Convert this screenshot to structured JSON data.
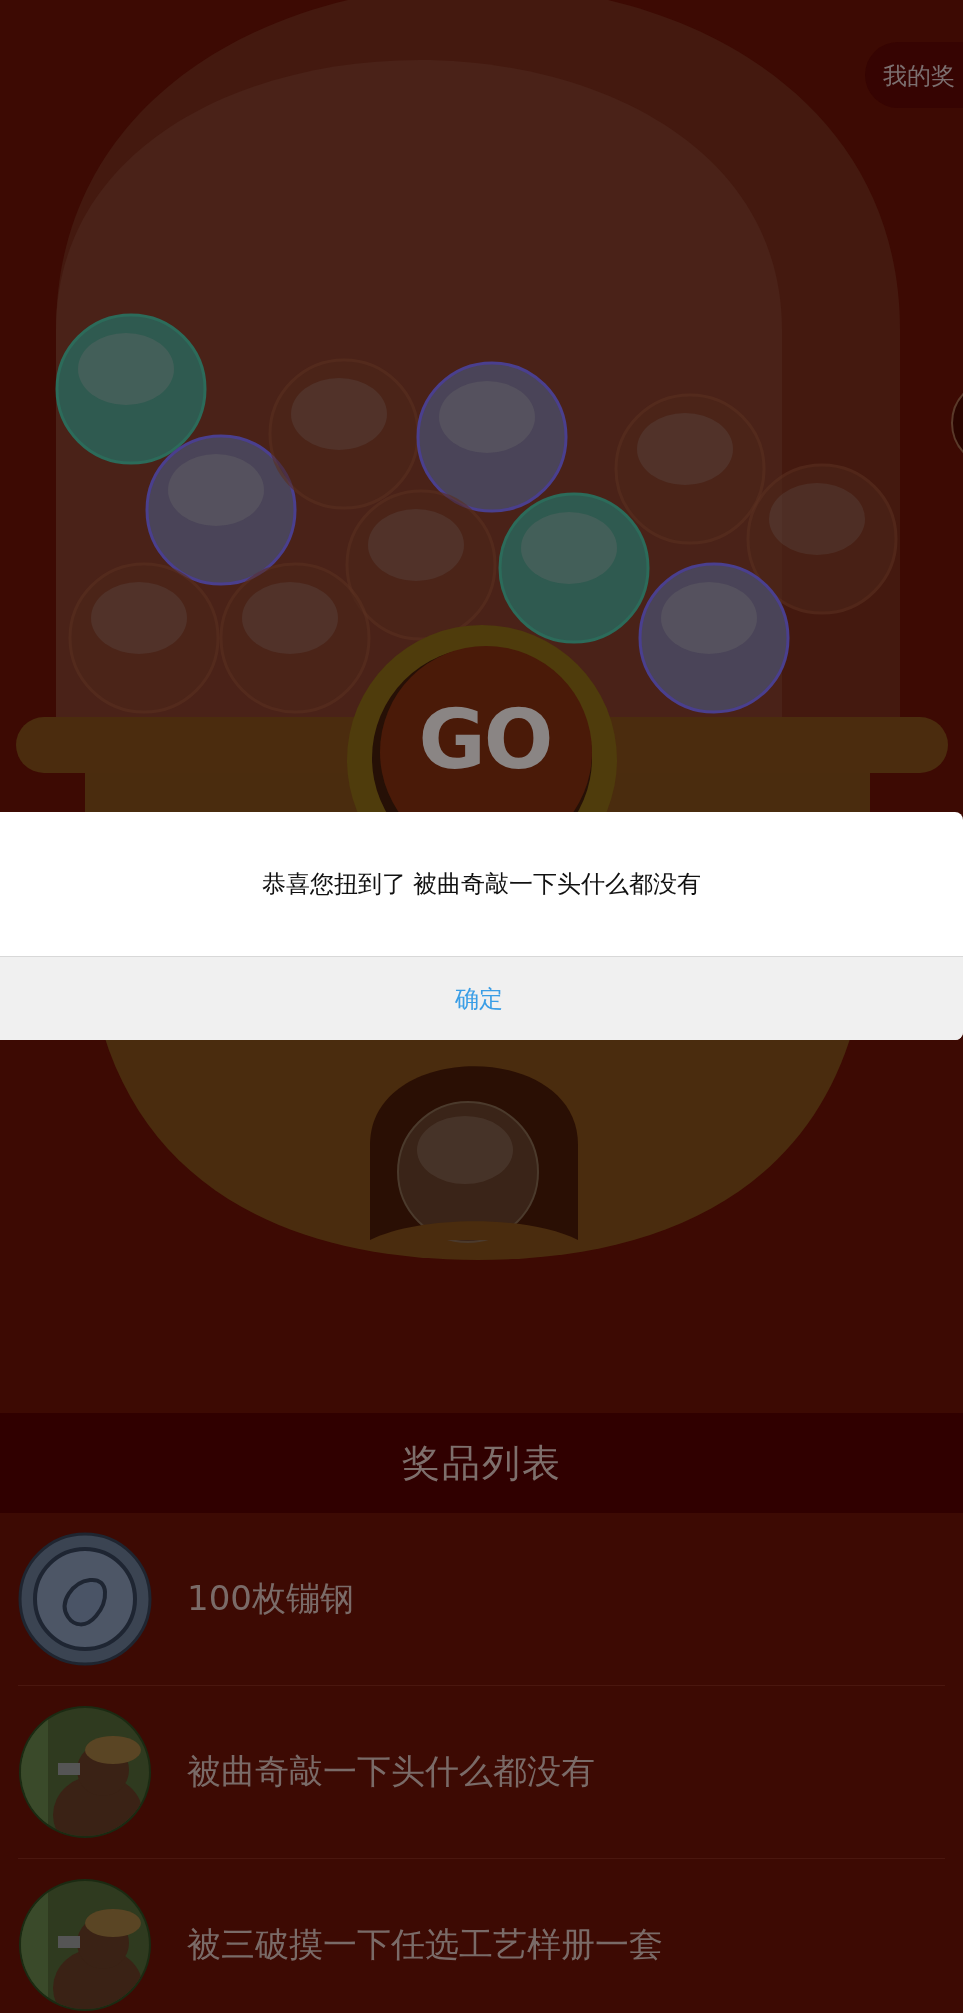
{
  "top_button": {
    "label": "我的奖"
  },
  "go_button": {
    "label": "GO"
  },
  "dialog": {
    "message": "恭喜您扭到了 被曲奇敲一下头什么都没有",
    "button": "确定"
  },
  "prize_list": {
    "title": "奖品列表",
    "items": [
      {
        "name": "100枚镚钢",
        "kind": "coin"
      },
      {
        "name": "被曲奇敲一下头什么都没有",
        "kind": "picture"
      },
      {
        "name": "被三破摸一下任选工艺样册一套",
        "kind": "picture"
      }
    ]
  }
}
